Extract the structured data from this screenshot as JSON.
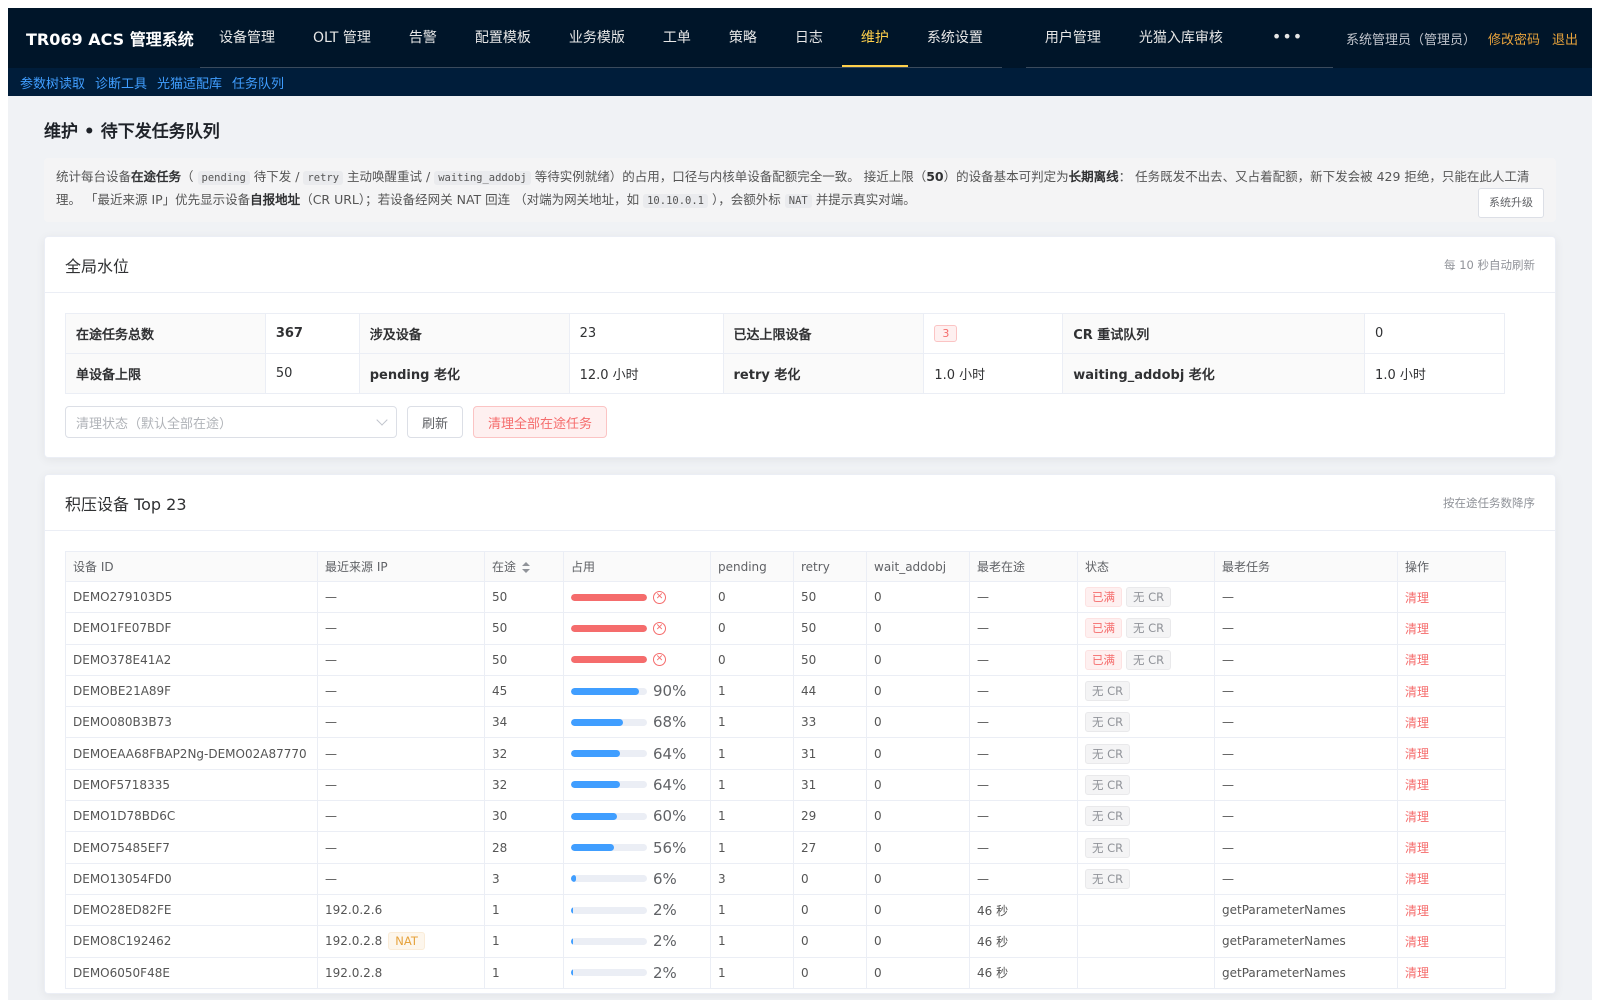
{
  "app": {
    "brand": "TR069 ACS 管理系统",
    "menu": [
      {
        "label": "设备管理",
        "active": false
      },
      {
        "label": "OLT 管理",
        "active": false
      },
      {
        "label": "告警",
        "active": false
      },
      {
        "label": "配置模板",
        "active": false
      },
      {
        "label": "业务模版",
        "active": false
      },
      {
        "label": "工单",
        "active": false
      },
      {
        "label": "策略",
        "active": false
      },
      {
        "label": "日志",
        "active": false
      },
      {
        "label": "维护",
        "active": true
      },
      {
        "label": "系统设置",
        "active": false
      }
    ],
    "menu2": [
      {
        "label": "用户管理"
      },
      {
        "label": "光猫入库审核"
      },
      {
        "label": "•••"
      }
    ],
    "user": "系统管理员（管理员）",
    "change_password": "修改密码",
    "logout": "退出"
  },
  "subnav": [
    "参数树读取",
    "诊断工具",
    "光猫适配库",
    "任务队列"
  ],
  "page": {
    "title": "维护 • 待下发任务队列",
    "notice": {
      "t1": "统计每台设备",
      "b1": "在途任务",
      "t2": "（",
      "c1": "pending",
      "t3": "待下发 /",
      "c2": "retry",
      "t4": "主动唤醒重试 /",
      "c3": "waiting_addobj",
      "t5": "等待实例就绪）的占用，口径与内核单设备配额完全一致。 接近上限（",
      "b2": "50",
      "t6": "）的设备基本可判定为",
      "b3": "长期离线",
      "t7": "： 任务既发不出去、又占着配额，新下发会被 429 拒绝，只能在此人工清理。 「最近来源 IP」优先显示设备",
      "b4": "自报地址",
      "t8": "（CR URL）；若设备经网关 NAT 回连 （对端为网关地址，如",
      "c4": "10.10.0.1",
      "t9": "），会额外标",
      "c5": "NAT",
      "t10": "并提示真实对端。",
      "upgrade": "系统升级"
    }
  },
  "watermark": {
    "title": "全局水位",
    "hint": "每 10 秒自动刷新",
    "rows": [
      [
        {
          "k": "在途任务总数",
          "v": "367",
          "bold": true
        },
        {
          "k": "涉及设备",
          "v": "23"
        },
        {
          "k": "已达上限设备",
          "v": "3",
          "tag": true
        },
        {
          "k": "CR 重试队列",
          "v": "0"
        }
      ],
      [
        {
          "k": "单设备上限",
          "v": "50"
        },
        {
          "k": "pending 老化",
          "v": "12.0 小时"
        },
        {
          "k": "retry 老化",
          "v": "1.0 小时"
        },
        {
          "k": "waiting_addobj 老化",
          "v": "1.0 小时"
        }
      ]
    ],
    "select_placeholder": "清理状态（默认全部在途）",
    "refresh": "刷新",
    "clear_all": "清理全部在途任务"
  },
  "backlog": {
    "title": "积压设备 Top 23",
    "hint": "按在途任务数降序",
    "columns": [
      "设备 ID",
      "最近来源 IP",
      "在途",
      "占用",
      "pending",
      "retry",
      "wait_addobj",
      "最老在途",
      "状态",
      "最老任务",
      "操作"
    ],
    "rows": [
      {
        "id": "DEMO279103D5",
        "ip": "—",
        "nat": "",
        "inflight": "50",
        "occupancy": 100,
        "pct": "",
        "full": true,
        "pending": "0",
        "retry": "50",
        "wait": "0",
        "oldest": "—",
        "tags": [
          "已满",
          "无 CR"
        ],
        "task": "—",
        "op": "清理"
      },
      {
        "id": "DEMO1FE07BDF",
        "ip": "—",
        "nat": "",
        "inflight": "50",
        "occupancy": 100,
        "pct": "",
        "full": true,
        "pending": "0",
        "retry": "50",
        "wait": "0",
        "oldest": "—",
        "tags": [
          "已满",
          "无 CR"
        ],
        "task": "—",
        "op": "清理"
      },
      {
        "id": "DEMO378E41A2",
        "ip": "—",
        "nat": "",
        "inflight": "50",
        "occupancy": 100,
        "pct": "",
        "full": true,
        "pending": "0",
        "retry": "50",
        "wait": "0",
        "oldest": "—",
        "tags": [
          "已满",
          "无 CR"
        ],
        "task": "—",
        "op": "清理"
      },
      {
        "id": "DEMOBE21A89F",
        "ip": "—",
        "nat": "",
        "inflight": "45",
        "occupancy": 90,
        "pct": "90%",
        "full": false,
        "pending": "1",
        "retry": "44",
        "wait": "0",
        "oldest": "—",
        "tags": [
          "无 CR"
        ],
        "task": "—",
        "op": "清理"
      },
      {
        "id": "DEMO080B3B73",
        "ip": "—",
        "nat": "",
        "inflight": "34",
        "occupancy": 68,
        "pct": "68%",
        "full": false,
        "pending": "1",
        "retry": "33",
        "wait": "0",
        "oldest": "—",
        "tags": [
          "无 CR"
        ],
        "task": "—",
        "op": "清理"
      },
      {
        "id": "DEMOEAA68FBAP2Ng-DEMO02A87770",
        "ip": "—",
        "nat": "",
        "inflight": "32",
        "occupancy": 64,
        "pct": "64%",
        "full": false,
        "pending": "1",
        "retry": "31",
        "wait": "0",
        "oldest": "—",
        "tags": [
          "无 CR"
        ],
        "task": "—",
        "op": "清理"
      },
      {
        "id": "DEMOF5718335",
        "ip": "—",
        "nat": "",
        "inflight": "32",
        "occupancy": 64,
        "pct": "64%",
        "full": false,
        "pending": "1",
        "retry": "31",
        "wait": "0",
        "oldest": "—",
        "tags": [
          "无 CR"
        ],
        "task": "—",
        "op": "清理"
      },
      {
        "id": "DEMO1D78BD6C",
        "ip": "—",
        "nat": "",
        "inflight": "30",
        "occupancy": 60,
        "pct": "60%",
        "full": false,
        "pending": "1",
        "retry": "29",
        "wait": "0",
        "oldest": "—",
        "tags": [
          "无 CR"
        ],
        "task": "—",
        "op": "清理"
      },
      {
        "id": "DEMO75485EF7",
        "ip": "—",
        "nat": "",
        "inflight": "28",
        "occupancy": 56,
        "pct": "56%",
        "full": false,
        "pending": "1",
        "retry": "27",
        "wait": "0",
        "oldest": "—",
        "tags": [
          "无 CR"
        ],
        "task": "—",
        "op": "清理"
      },
      {
        "id": "DEMO13054FD0",
        "ip": "—",
        "nat": "",
        "inflight": "3",
        "occupancy": 6,
        "pct": "6%",
        "full": false,
        "pending": "3",
        "retry": "0",
        "wait": "0",
        "oldest": "—",
        "tags": [
          "无 CR"
        ],
        "task": "—",
        "op": "清理"
      },
      {
        "id": "DEMO28ED82FE",
        "ip": "192.0.2.6",
        "nat": "",
        "inflight": "1",
        "occupancy": 2,
        "pct": "2%",
        "full": false,
        "pending": "1",
        "retry": "0",
        "wait": "0",
        "oldest": "46 秒",
        "tags": [],
        "task": "getParameterNames",
        "op": "清理"
      },
      {
        "id": "DEMO8C192462",
        "ip": "192.0.2.8",
        "nat": "NAT",
        "inflight": "1",
        "occupancy": 2,
        "pct": "2%",
        "full": false,
        "pending": "1",
        "retry": "0",
        "wait": "0",
        "oldest": "46 秒",
        "tags": [],
        "task": "getParameterNames",
        "op": "清理"
      },
      {
        "id": "DEMO6050F48E",
        "ip": "192.0.2.8",
        "nat": "",
        "inflight": "1",
        "occupancy": 2,
        "pct": "2%",
        "full": false,
        "pending": "1",
        "retry": "0",
        "wait": "0",
        "oldest": "46 秒",
        "tags": [],
        "task": "getParameterNames",
        "op": "清理"
      }
    ]
  }
}
